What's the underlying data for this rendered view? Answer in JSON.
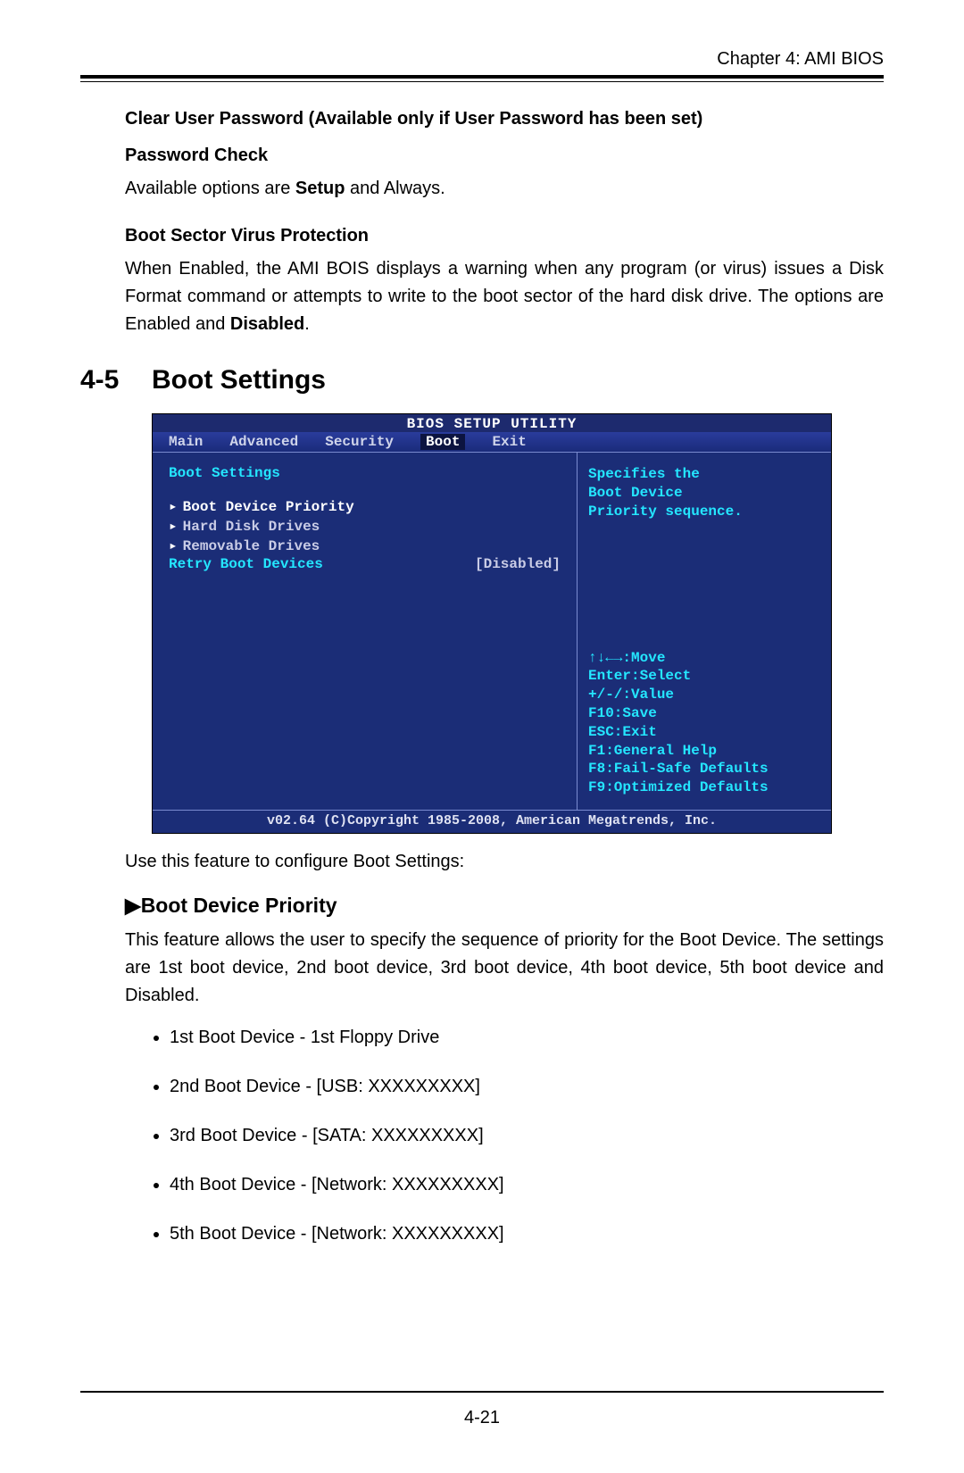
{
  "chapter": "Chapter 4: AMI BIOS",
  "clear_user_pw": "Clear User Password (Available only if User Password has been set)",
  "password_check": "Password Check",
  "pw_check_body_pre": "Available options are ",
  "pw_check_body_bold": "Setup",
  "pw_check_body_post": " and Always.",
  "bsvp_head": "Boot Sector Virus Protection",
  "bsvp_body_pre": "When Enabled, the AMI BOIS displays a warning when any program (or virus) issues a Disk Format command or attempts to write to the boot sector of the hard disk drive. The options are Enabled and ",
  "bsvp_body_bold": "Disabled",
  "bsvp_body_post": ".",
  "section_num": "4-5",
  "section_title": "Boot Settings",
  "bios": {
    "title": "BIOS SETUP UTILITY",
    "menu": [
      "Main",
      "Advanced",
      "Security",
      "Boot",
      "Exit"
    ],
    "active_menu": "Boot",
    "left_header": "Boot Settings",
    "items": [
      "Boot Device Priority",
      "Hard Disk Drives",
      "Removable Drives"
    ],
    "retry_label": "Retry Boot Devices",
    "retry_value": "[Disabled]",
    "help_top": [
      "Specifies the",
      "Boot Device",
      "Priority sequence."
    ],
    "help_bot": [
      "↑↓←→:Move",
      "Enter:Select",
      "+/-/:Value",
      "F10:Save",
      "ESC:Exit",
      "F1:General Help",
      "F8:Fail-Safe Defaults",
      "F9:Optimized Defaults"
    ],
    "footer": "v02.64 (C)Copyright 1985-2008, American Megatrends, Inc."
  },
  "after_bios": "Use this feature to configure Boot Settings:",
  "bdp_head": "▶Boot Device Priority",
  "bdp_body": "This feature allows the user to specify the sequence of priority for the Boot Device. The settings are 1st boot device, 2nd boot device, 3rd boot device, 4th boot device, 5th boot device and Disabled.",
  "devices": [
    "1st Boot Device - 1st Floppy Drive",
    "2nd Boot Device - [USB: XXXXXXXXX]",
    "3rd Boot Device - [SATA: XXXXXXXXX]",
    "4th Boot Device - [Network: XXXXXXXXX]",
    "5th Boot Device - [Network: XXXXXXXXX]"
  ],
  "page_number": "4-21"
}
